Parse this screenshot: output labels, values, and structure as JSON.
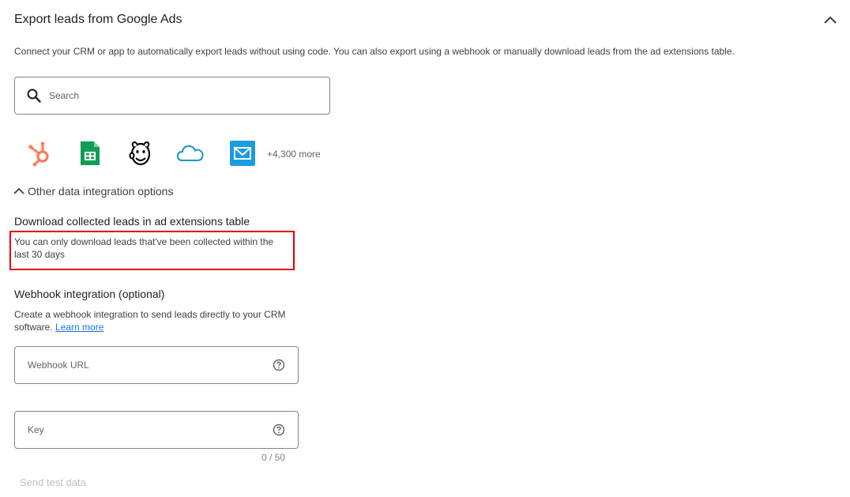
{
  "header": {
    "title": "Export leads from Google Ads",
    "collapse_icon": "chevron-up-icon"
  },
  "description": "Connect your CRM or app to automatically export leads without using code. You can also export using a webhook or manually download leads from the ad extensions table.",
  "search": {
    "placeholder": "Search",
    "icon": "search-icon"
  },
  "apps": {
    "items": [
      {
        "name": "hubspot-icon",
        "color": "#ff7a59"
      },
      {
        "name": "google-sheets-icon",
        "color": "#0f9d58"
      },
      {
        "name": "mailchimp-icon",
        "color": "#000000"
      },
      {
        "name": "salesforce-cloud-icon",
        "color": "#1798c1"
      },
      {
        "name": "email-app-icon",
        "color": "#1c9be0"
      }
    ],
    "more_label": "+4,300 more"
  },
  "other_options": {
    "label": "Other data integration options",
    "icon": "chevron-up-icon"
  },
  "download": {
    "title": "Download collected leads in ad extensions table",
    "note_line1": "You can only download leads that've been collected within the",
    "note_line2": "last 30 days",
    "highlight_color": "#e60000"
  },
  "webhook": {
    "title": "Webhook integration (optional)",
    "desc_line1": "Create a webhook integration to send leads directly to your CRM",
    "desc_line2_prefix": "software.",
    "learn_more": "Learn more",
    "url_placeholder": "Webhook URL",
    "key_placeholder": "Key",
    "key_counter": "0 / 50",
    "send_test_label": "Send test data"
  },
  "colors": {
    "link": "#1a73e8",
    "border": "#80868b",
    "disabled": "#bdc1c6"
  }
}
